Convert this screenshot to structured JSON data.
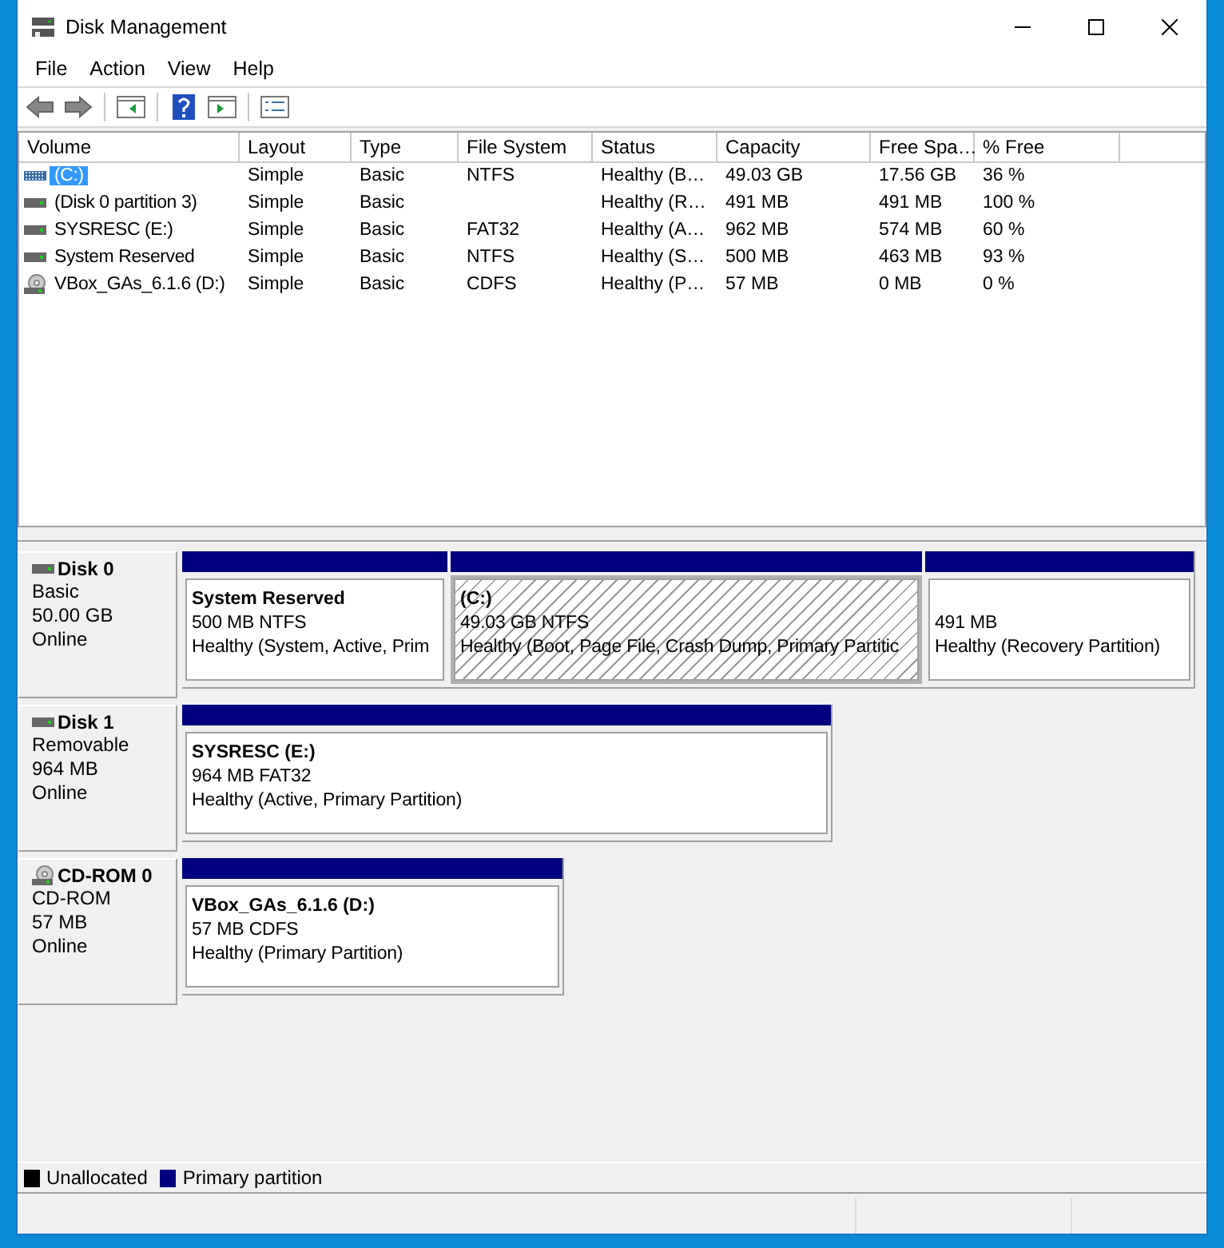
{
  "window": {
    "title": "Disk Management"
  },
  "menu": [
    "File",
    "Action",
    "View",
    "Help"
  ],
  "volume_table": {
    "columns": [
      "Volume",
      "Layout",
      "Type",
      "File System",
      "Status",
      "Capacity",
      "Free Spa…",
      "% Free"
    ],
    "rows": [
      {
        "kind": "striped",
        "selected": true,
        "cells": [
          "(C:)",
          "Simple",
          "Basic",
          "NTFS",
          "Healthy (B…",
          "49.03 GB",
          "17.56 GB",
          "36 %"
        ]
      },
      {
        "kind": "disk",
        "selected": false,
        "cells": [
          "(Disk 0 partition 3)",
          "Simple",
          "Basic",
          "",
          "Healthy (R…",
          "491 MB",
          "491 MB",
          "100 %"
        ]
      },
      {
        "kind": "disk",
        "selected": false,
        "cells": [
          "SYSRESC (E:)",
          "Simple",
          "Basic",
          "FAT32",
          "Healthy (A…",
          "962 MB",
          "574 MB",
          "60 %"
        ]
      },
      {
        "kind": "disk",
        "selected": false,
        "cells": [
          "System Reserved",
          "Simple",
          "Basic",
          "NTFS",
          "Healthy (S…",
          "500 MB",
          "463 MB",
          "93 %"
        ]
      },
      {
        "kind": "cd",
        "selected": false,
        "cells": [
          "VBox_GAs_6.1.6 (D:)",
          "Simple",
          "Basic",
          "CDFS",
          "Healthy (P…",
          "57 MB",
          "0 MB",
          "0 %"
        ]
      }
    ]
  },
  "disks": [
    {
      "kind": "disk",
      "name": "Disk 0",
      "type": "Basic",
      "size": "50.00 GB",
      "status": "Online",
      "partitions": [
        {
          "name": "System Reserved",
          "size": "500 MB NTFS",
          "status": "Healthy (System, Active, Prim",
          "selected": false
        },
        {
          "name": "(C:)",
          "size": "49.03 GB NTFS",
          "status": "Healthy (Boot, Page File, Crash Dump, Primary Partitic",
          "selected": true
        },
        {
          "size": "491 MB",
          "status": "Healthy (Recovery Partition)",
          "selected": false
        }
      ]
    },
    {
      "kind": "disk",
      "name": "Disk 1",
      "type": "Removable",
      "size": "964 MB",
      "status": "Online",
      "partitions": [
        {
          "name": "SYSRESC  (E:)",
          "size": "964 MB FAT32",
          "status": "Healthy (Active, Primary Partition)",
          "selected": false
        }
      ]
    },
    {
      "kind": "cd",
      "name": "CD-ROM 0",
      "type": "CD-ROM",
      "size": "57 MB",
      "status": "Online",
      "partitions": [
        {
          "name": "VBox_GAs_6.1.6  (D:)",
          "size": "57 MB CDFS",
          "status": "Healthy (Primary Partition)",
          "selected": false
        }
      ]
    }
  ],
  "legend": [
    {
      "label": "Unallocated",
      "color": "#000000"
    },
    {
      "label": "Primary partition",
      "color": "#000080"
    }
  ]
}
